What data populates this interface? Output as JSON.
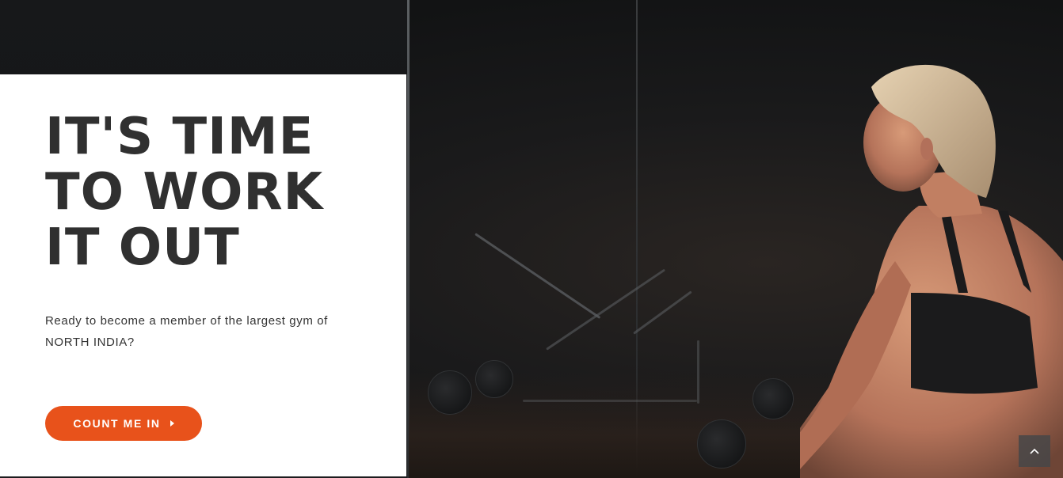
{
  "hero": {
    "headline_lines": [
      "IT'S TIME",
      "TO WORK",
      "IT OUT"
    ],
    "subtext_lines": [
      "Ready to become a member of the largest gym of",
      "NORTH INDIA?"
    ],
    "cta_label": "COUNT ME IN",
    "cta_icon": "caret-right-icon"
  },
  "back_to_top": {
    "icon": "chevron-up-icon"
  },
  "colors": {
    "accent": "#e8521b",
    "headline": "#303030",
    "card_bg": "#ffffff",
    "photo_bg": "#141517"
  }
}
